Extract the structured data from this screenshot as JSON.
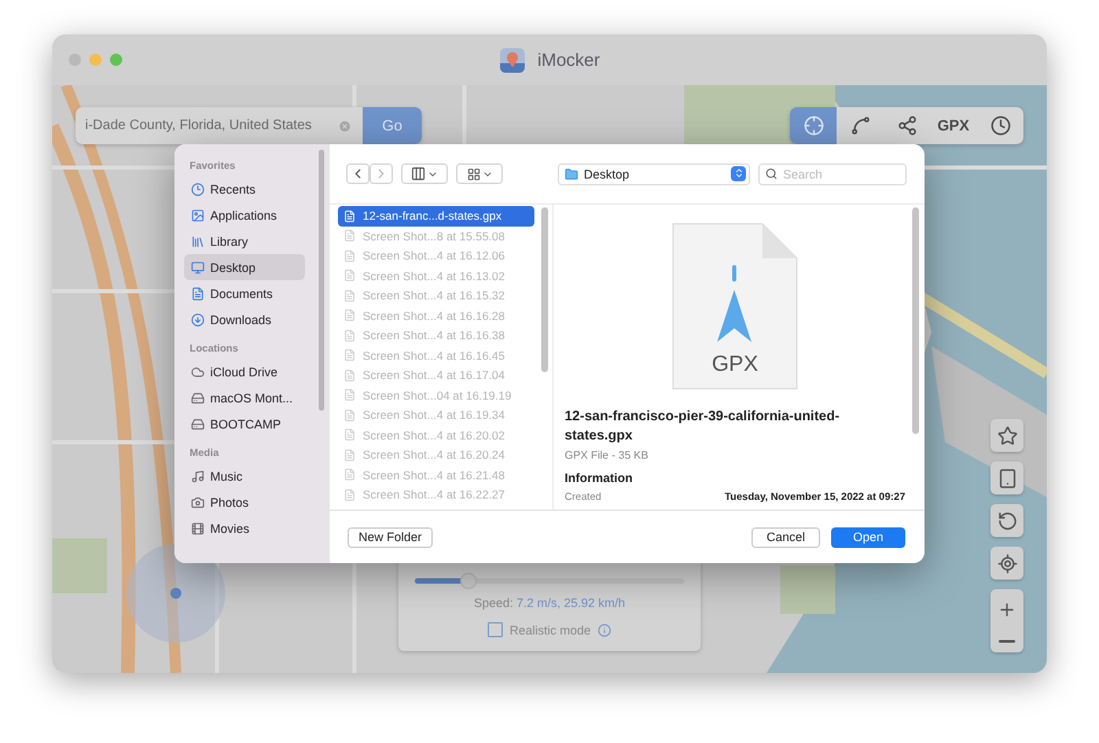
{
  "window": {
    "title": "iMocker"
  },
  "search": {
    "value": "i-Dade County, Florida, United States",
    "button": "Go"
  },
  "toolbar": [
    {
      "kind": "icon",
      "selected": true
    },
    {
      "kind": "icon",
      "selected": false
    },
    {
      "kind": "icon",
      "selected": false
    },
    {
      "kind": "text",
      "label": "GPX",
      "selected": false
    },
    {
      "kind": "icon",
      "selected": false
    }
  ],
  "dialog": {
    "sidebar": [
      {
        "title": "Favorites",
        "items": [
          {
            "label": "Recents",
            "selected": false
          },
          {
            "label": "Applications",
            "selected": false
          },
          {
            "label": "Library",
            "selected": false
          },
          {
            "label": "Desktop",
            "selected": true
          },
          {
            "label": "Documents",
            "selected": false
          },
          {
            "label": "Downloads",
            "selected": false
          }
        ]
      },
      {
        "title": "Locations",
        "items": [
          {
            "label": "iCloud Drive",
            "selected": false
          },
          {
            "label": "macOS Mont...",
            "selected": false
          },
          {
            "label": "BOOTCAMP",
            "selected": false
          }
        ]
      },
      {
        "title": "Media",
        "items": [
          {
            "label": "Music",
            "selected": false
          },
          {
            "label": "Photos",
            "selected": false
          },
          {
            "label": "Movies",
            "selected": false
          }
        ]
      }
    ],
    "location": "Desktop",
    "search": {
      "placeholder": "Search"
    },
    "files": [
      {
        "name": "12-san-franc...d-states.gpx",
        "selected": true,
        "disabled": false
      },
      {
        "name": "Screen Shot...8 at 15.55.08",
        "selected": false,
        "disabled": true
      },
      {
        "name": "Screen Shot...4 at 16.12.06",
        "selected": false,
        "disabled": true
      },
      {
        "name": "Screen Shot...4 at 16.13.02",
        "selected": false,
        "disabled": true
      },
      {
        "name": "Screen Shot...4 at 16.15.32",
        "selected": false,
        "disabled": true
      },
      {
        "name": "Screen Shot...4 at 16.16.28",
        "selected": false,
        "disabled": true
      },
      {
        "name": "Screen Shot...4 at 16.16.38",
        "selected": false,
        "disabled": true
      },
      {
        "name": "Screen Shot...4 at 16.16.45",
        "selected": false,
        "disabled": true
      },
      {
        "name": "Screen Shot...4 at 16.17.04",
        "selected": false,
        "disabled": true
      },
      {
        "name": "Screen Shot...04 at 16.19.19",
        "selected": false,
        "disabled": true
      },
      {
        "name": "Screen Shot...4 at 16.19.34",
        "selected": false,
        "disabled": true
      },
      {
        "name": "Screen Shot...4 at 16.20.02",
        "selected": false,
        "disabled": true
      },
      {
        "name": "Screen Shot...4 at 16.20.24",
        "selected": false,
        "disabled": true
      },
      {
        "name": "Screen Shot...4 at 16.21.48",
        "selected": false,
        "disabled": true
      },
      {
        "name": "Screen Shot...4 at 16.22.27",
        "selected": false,
        "disabled": true
      }
    ],
    "preview": {
      "file_type_badge": "GPX",
      "name": "12-san-francisco-pier-39-california-united-states.gpx",
      "details": "GPX File - 35 KB",
      "info_heading": "Information",
      "created_label": "Created",
      "created_value": "Tuesday, November 15, 2022 at 09:27"
    },
    "buttons": {
      "new_folder": "New Folder",
      "cancel": "Cancel",
      "open": "Open"
    }
  },
  "speed_panel": {
    "level": 0.2,
    "label": "Speed:",
    "value": "7.2 m/s, 25.92 km/h",
    "realistic_mode": {
      "label": "Realistic mode",
      "checked": false
    }
  }
}
